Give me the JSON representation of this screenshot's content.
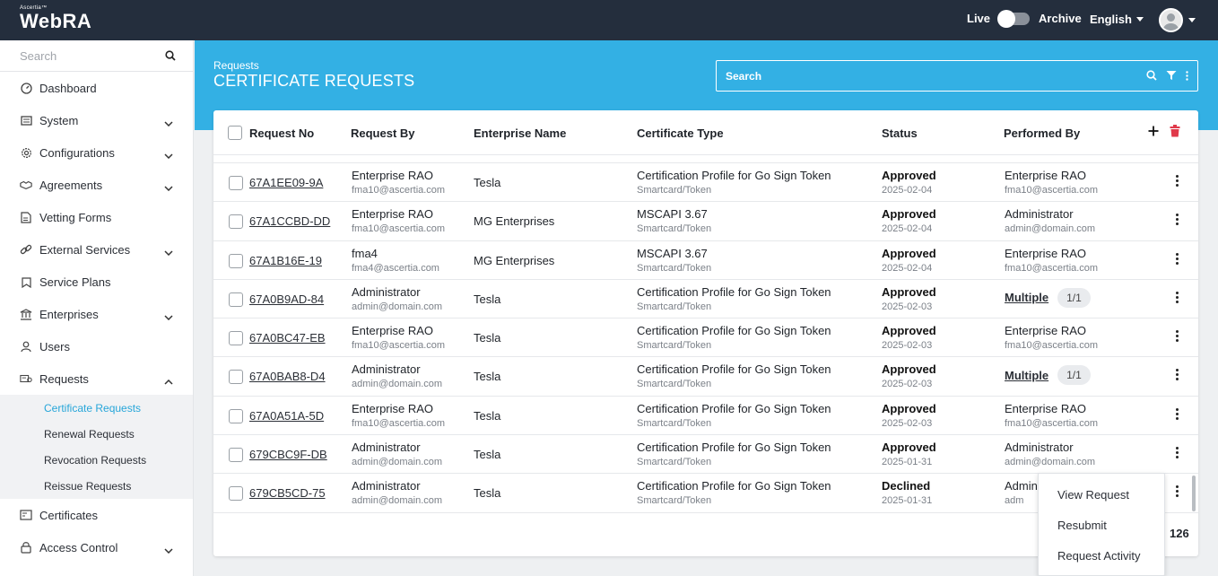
{
  "app": {
    "brand_small": "Ascertia™",
    "brand": "WebRA",
    "live_label": "Live",
    "archive_label": "Archive",
    "language": "English"
  },
  "sidebar": {
    "search_placeholder": "Search",
    "items": [
      {
        "label": "Dashboard",
        "icon": "dashboard-icon"
      },
      {
        "label": "System",
        "icon": "system-icon"
      },
      {
        "label": "Configurations",
        "icon": "gear-icon"
      },
      {
        "label": "Agreements",
        "icon": "handshake-icon"
      },
      {
        "label": "Vetting Forms",
        "icon": "form-icon"
      },
      {
        "label": "External Services",
        "icon": "link-icon"
      },
      {
        "label": "Service Plans",
        "icon": "plan-icon"
      },
      {
        "label": "Enterprises",
        "icon": "bank-icon"
      },
      {
        "label": "Users",
        "icon": "user-icon"
      },
      {
        "label": "Requests",
        "icon": "requests-icon"
      },
      {
        "label": "Certificates",
        "icon": "certificate-icon"
      },
      {
        "label": "Access Control",
        "icon": "lock-icon"
      }
    ],
    "sub_items": [
      "Certificate Requests",
      "Renewal Requests",
      "Revocation Requests",
      "Reissue Requests"
    ]
  },
  "header": {
    "breadcrumb": "Requests",
    "title": "CERTIFICATE REQUESTS",
    "search_placeholder": "Search"
  },
  "table": {
    "columns": [
      "Request No",
      "Request By",
      "Enterprise Name",
      "Certificate Type",
      "Status",
      "Performed By"
    ],
    "rows": [
      {
        "id": "67A1EE09-9A",
        "by_name": "Enterprise RAO",
        "by_email": "fma10@ascertia.com",
        "enterprise": "Tesla",
        "cert": "Certification Profile for Go Sign Token",
        "cert_sub": "Smartcard/Token",
        "status": "Approved",
        "date": "2025-02-04",
        "perf_name": "Enterprise RAO",
        "perf_email": "fma10@ascertia.com"
      },
      {
        "id": "67A1CCBD-DD",
        "by_name": "Enterprise RAO",
        "by_email": "fma10@ascertia.com",
        "enterprise": "MG Enterprises",
        "cert": "MSCAPI 3.67",
        "cert_sub": "Smartcard/Token",
        "status": "Approved",
        "date": "2025-02-04",
        "perf_name": "Administrator",
        "perf_email": "admin@domain.com"
      },
      {
        "id": "67A1B16E-19",
        "by_name": "fma4",
        "by_email": "fma4@ascertia.com",
        "enterprise": "MG Enterprises",
        "cert": "MSCAPI 3.67",
        "cert_sub": "Smartcard/Token",
        "status": "Approved",
        "date": "2025-02-04",
        "perf_name": "Enterprise RAO",
        "perf_email": "fma10@ascertia.com"
      },
      {
        "id": "67A0B9AD-84",
        "by_name": "Administrator",
        "by_email": "admin@domain.com",
        "enterprise": "Tesla",
        "cert": "Certification Profile for Go Sign Token",
        "cert_sub": "Smartcard/Token",
        "status": "Approved",
        "date": "2025-02-03",
        "multi": "Multiple",
        "multi_count": "1/1"
      },
      {
        "id": "67A0BC47-EB",
        "by_name": "Enterprise RAO",
        "by_email": "fma10@ascertia.com",
        "enterprise": "Tesla",
        "cert": "Certification Profile for Go Sign Token",
        "cert_sub": "Smartcard/Token",
        "status": "Approved",
        "date": "2025-02-03",
        "perf_name": "Enterprise RAO",
        "perf_email": "fma10@ascertia.com"
      },
      {
        "id": "67A0BAB8-D4",
        "by_name": "Administrator",
        "by_email": "admin@domain.com",
        "enterprise": "Tesla",
        "cert": "Certification Profile for Go Sign Token",
        "cert_sub": "Smartcard/Token",
        "status": "Approved",
        "date": "2025-02-03",
        "multi": "Multiple",
        "multi_count": "1/1"
      },
      {
        "id": "67A0A51A-5D",
        "by_name": "Enterprise RAO",
        "by_email": "fma10@ascertia.com",
        "enterprise": "Tesla",
        "cert": "Certification Profile for Go Sign Token",
        "cert_sub": "Smartcard/Token",
        "status": "Approved",
        "date": "2025-02-03",
        "perf_name": "Enterprise RAO",
        "perf_email": "fma10@ascertia.com"
      },
      {
        "id": "679CBC9F-DB",
        "by_name": "Administrator",
        "by_email": "admin@domain.com",
        "enterprise": "Tesla",
        "cert": "Certification Profile for Go Sign Token",
        "cert_sub": "Smartcard/Token",
        "status": "Approved",
        "date": "2025-01-31",
        "perf_name": "Administrator",
        "perf_email": "admin@domain.com"
      },
      {
        "id": "679CB5CD-75",
        "by_name": "Administrator",
        "by_email": "admin@domain.com",
        "enterprise": "Tesla",
        "cert": "Certification Profile for Go Sign Token",
        "cert_sub": "Smartcard/Token",
        "status": "Declined",
        "date": "2025-01-31",
        "perf_name": "Admin",
        "perf_email": "adm"
      }
    ],
    "total": "126"
  },
  "context_menu": [
    "View Request",
    "Resubmit",
    "Request Activity"
  ],
  "colors": {
    "topbar": "#242e3d",
    "accent": "#33b0e4",
    "delete": "#e0394a"
  }
}
